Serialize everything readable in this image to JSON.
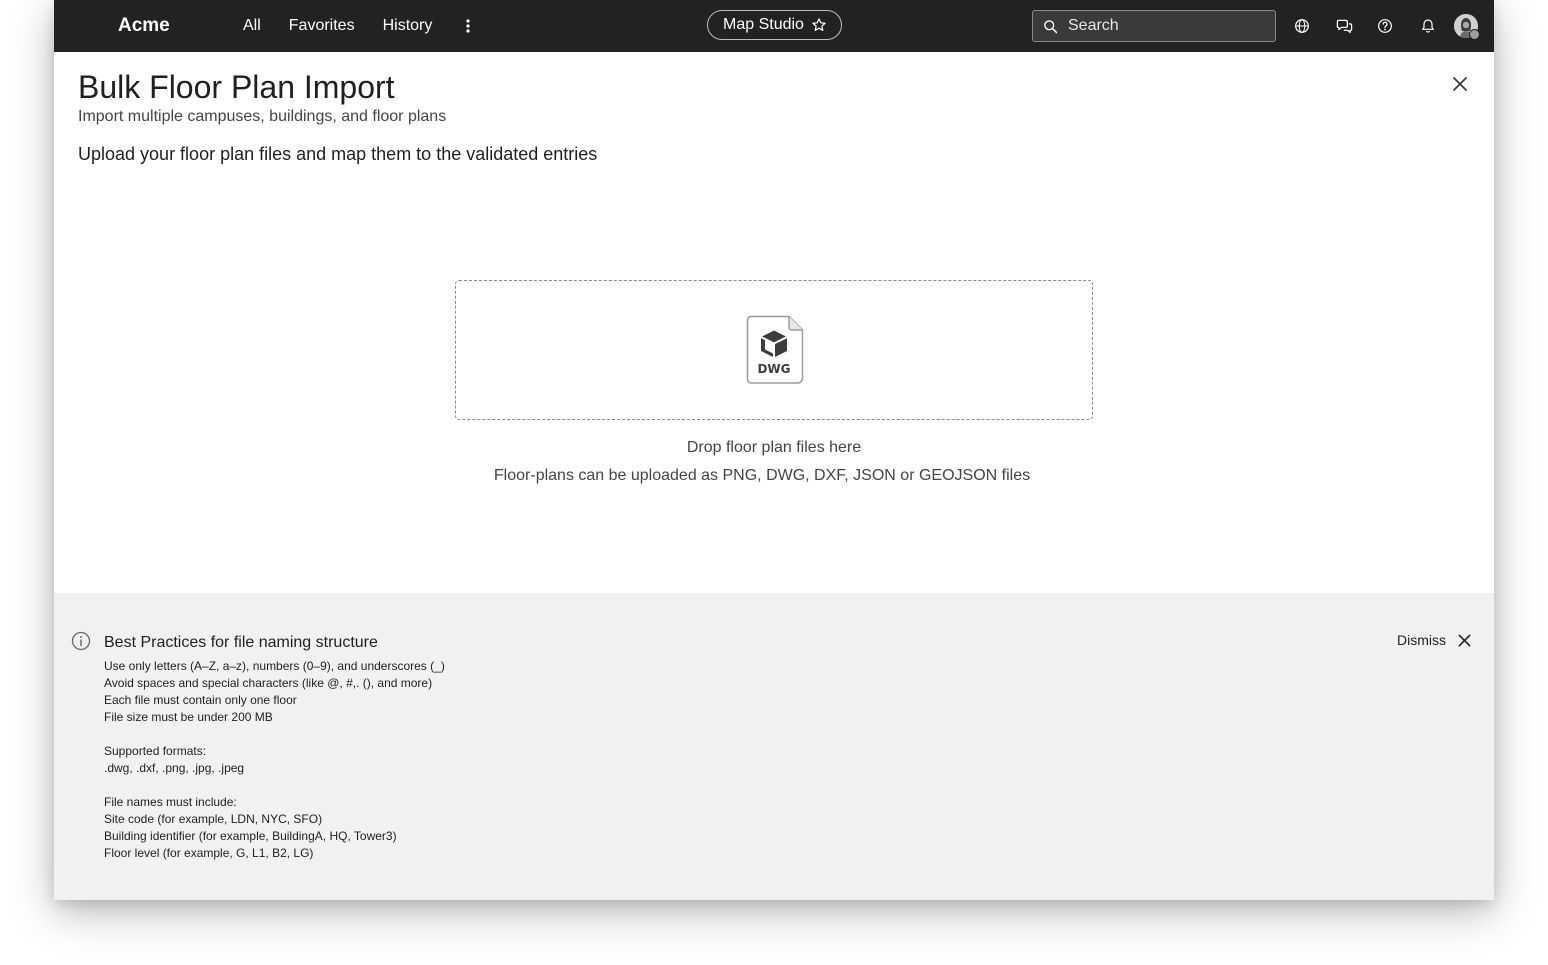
{
  "topbar": {
    "brand": "Acme",
    "nav": [
      "All",
      "Favorites",
      "History"
    ],
    "app_name": "Map Studio",
    "search_placeholder": "Search"
  },
  "header": {
    "title": "Bulk Floor Plan Import",
    "subtitle": "Import multiple campuses, buildings, and floor plans",
    "section_heading": "Upload your floor plan files and map them to the validated entries"
  },
  "dropzone": {
    "file_badge": "DWG",
    "title": "Drop floor plan files here",
    "hint": "Floor-plans can be uploaded as PNG, DWG, DXF, JSON or GEOJSON files"
  },
  "info_panel": {
    "title": "Best Practices for file naming structure",
    "dismiss_label": "Dismiss",
    "rules": [
      "Use only letters (A–Z, a–z), numbers (0–9), and underscores (_)",
      "Avoid spaces and special characters (like @, #,. (), and more)",
      "Each file must contain only one floor",
      "File size must be under 200 MB"
    ],
    "formats_heading": "Supported formats:",
    "formats": ".dwg, .dxf, .png, .jpg, .jpeg",
    "names_heading": "File names must include:",
    "name_parts": [
      "Site code (for example, LDN, NYC, SFO)",
      "Building identifier (for example, BuildingA, HQ, Tower3)",
      "Floor level (for example, G, L1, B2, LG)"
    ]
  },
  "colors": {
    "topbar_bg": "#222222",
    "info_panel_bg": "#f1f1f1",
    "text": "#1f1f1f"
  }
}
